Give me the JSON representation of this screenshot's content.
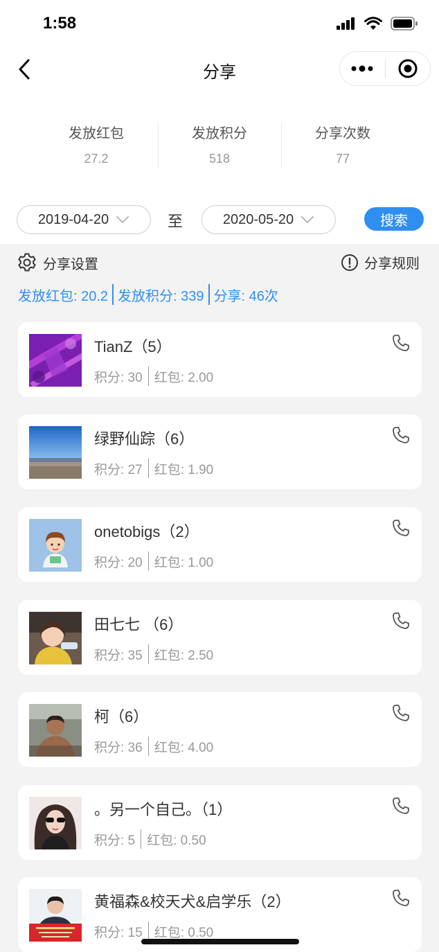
{
  "status_bar": {
    "time": "1:58"
  },
  "nav": {
    "title": "分享"
  },
  "stats": [
    {
      "label": "发放红包",
      "value": "27.2"
    },
    {
      "label": "发放积分",
      "value": "518"
    },
    {
      "label": "分享次数",
      "value": "77"
    }
  ],
  "filter": {
    "start_date": "2019-04-20",
    "to_label": "至",
    "end_date": "2020-05-20",
    "search_label": "搜索"
  },
  "tools": {
    "settings_label": "分享设置",
    "rules_label": "分享规则"
  },
  "summary": {
    "red_packet": "发放红包: 20.2",
    "points": "发放积分: 339",
    "shares": "分享: 46次"
  },
  "users": [
    {
      "name": "TianZ（5）",
      "points": "积分: 30",
      "red_packet": "红包: 2.00",
      "avatar_icon": "tianz-purple-avatar"
    },
    {
      "name": "绿野仙踪（6）",
      "points": "积分: 27",
      "red_packet": "红包: 1.90",
      "avatar_icon": "beach-sky-avatar"
    },
    {
      "name": "onetobigs（2）",
      "points": "积分: 20",
      "red_packet": "红包: 1.00",
      "avatar_icon": "cartoon-boy-avatar"
    },
    {
      "name": "田七七 （6）",
      "points": "积分: 35",
      "red_packet": "红包: 2.50",
      "avatar_icon": "child-photo-avatar"
    },
    {
      "name": "柯（6）",
      "points": "积分: 36",
      "red_packet": "红包: 4.00",
      "avatar_icon": "man-photo-avatar"
    },
    {
      "name": "。另一个自己。（1）",
      "points": "积分: 5",
      "red_packet": "红包: 0.50",
      "avatar_icon": "woman-sunglasses-avatar"
    },
    {
      "name": "黄福森&校天犬&启学乐（2）",
      "points": "积分: 15",
      "red_packet": "红包: 0.50",
      "avatar_icon": "man-red-banner-avatar"
    }
  ],
  "colors": {
    "accent": "#2f8ff0",
    "background": "#f3f3f3",
    "card": "#ffffff"
  }
}
